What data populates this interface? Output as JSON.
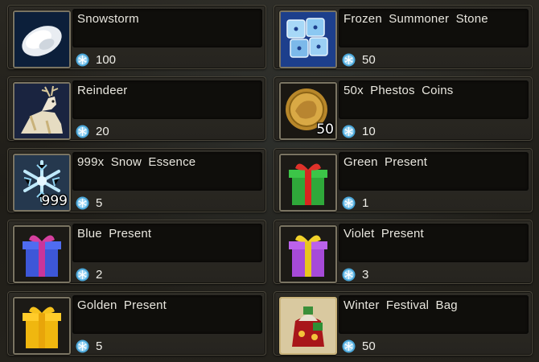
{
  "currency_icon": "snowflake-gem-icon",
  "items": [
    {
      "name": "Snowstorm",
      "price": "100",
      "icon": "snowstorm-icon"
    },
    {
      "name": "Frozen Summoner Stone",
      "price": "50",
      "icon": "frozen-summoner-stone-icon"
    },
    {
      "name": "Reindeer",
      "price": "20",
      "icon": "reindeer-icon"
    },
    {
      "name": "50x Phestos Coins",
      "price": "10",
      "icon": "phestos-coin-icon",
      "badge": "50"
    },
    {
      "name": "999x Snow Essence",
      "price": "5",
      "icon": "snow-essence-icon",
      "badge": "999"
    },
    {
      "name": "Green Present",
      "price": "1",
      "icon": "green-present-icon"
    },
    {
      "name": "Blue Present",
      "price": "2",
      "icon": "blue-present-icon"
    },
    {
      "name": "Violet Present",
      "price": "3",
      "icon": "violet-present-icon"
    },
    {
      "name": "Golden Present",
      "price": "5",
      "icon": "golden-present-icon"
    },
    {
      "name": "Winter Festival Bag",
      "price": "50",
      "icon": "winter-festival-bag-icon"
    }
  ],
  "colors": {
    "green_present": "#2fa83a",
    "blue_present": "#3d57d8",
    "violet_present": "#a64ad8",
    "golden_present": "#f0b70f",
    "ribbon_red": "#d8261f"
  }
}
